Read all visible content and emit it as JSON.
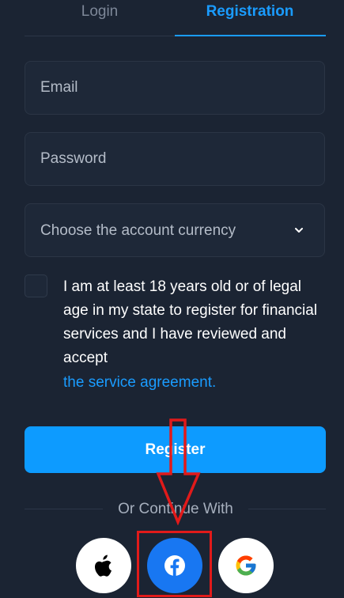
{
  "tabs": {
    "login": "Login",
    "registration": "Registration"
  },
  "form": {
    "email_placeholder": "Email",
    "password_placeholder": "Password",
    "currency_label": "Choose the account currency"
  },
  "agreement": {
    "text": "I am at least 18 years old or of legal age in my state to register for financial services and I have reviewed and accept",
    "link": "the service agreement."
  },
  "register_label": "Register",
  "divider_text": "Or Continue With",
  "social": [
    "apple-icon",
    "facebook-icon",
    "google-icon"
  ],
  "colors": {
    "background": "#1b2433",
    "accent": "#1a9cff",
    "register_button": "#0d9bff",
    "facebook": "#1877f2",
    "annotation": "#e11a1a"
  }
}
